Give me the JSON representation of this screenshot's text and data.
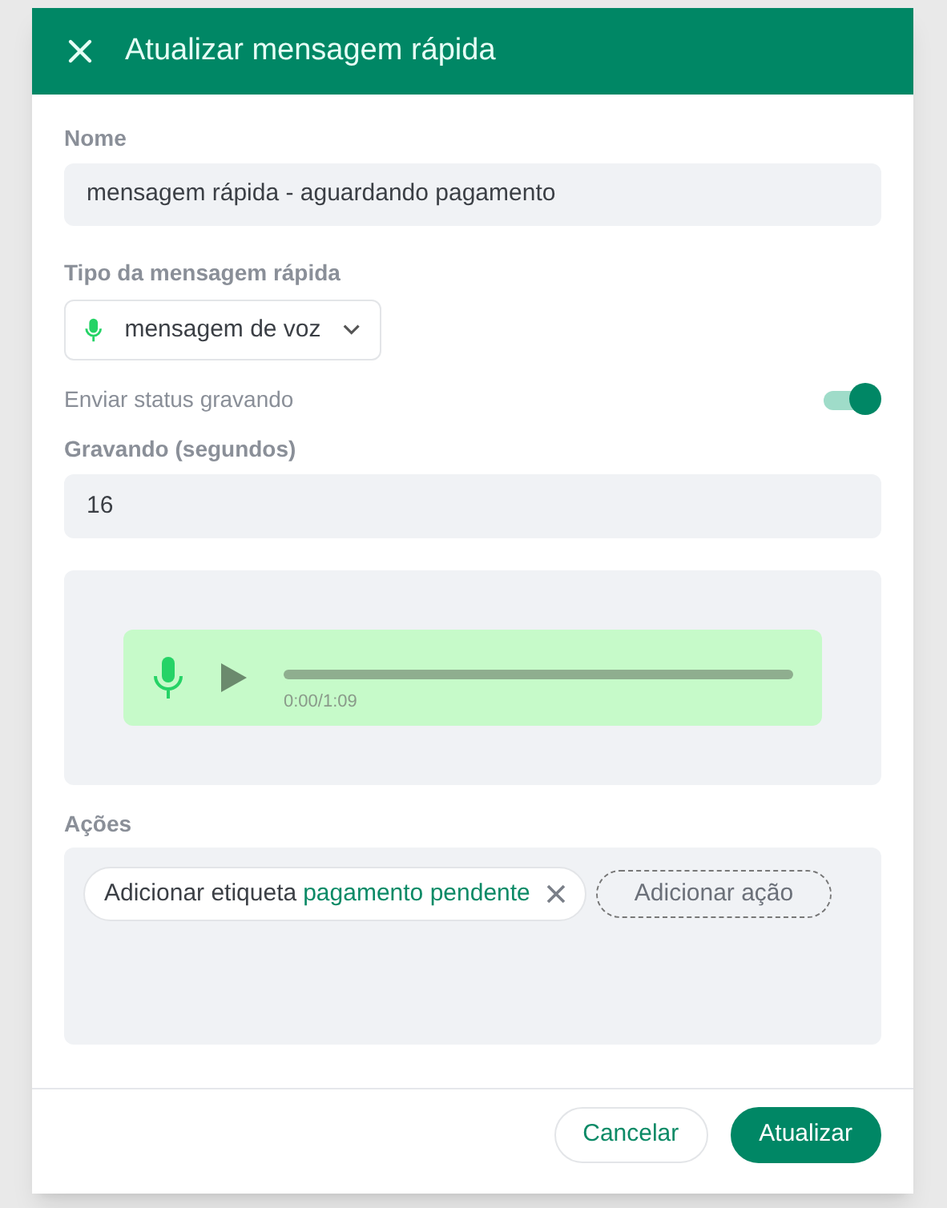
{
  "dialog": {
    "title": "Atualizar mensagem rápida"
  },
  "name_field": {
    "label": "Nome",
    "value": "mensagem rápida - aguardando pagamento"
  },
  "type_select": {
    "label": "Tipo da mensagem rápida",
    "value": "mensagem de voz"
  },
  "recording_status": {
    "label": "Enviar status gravando",
    "on": true
  },
  "seconds_field": {
    "label": "Gravando (segundos)",
    "value": "16"
  },
  "audio_player": {
    "time": "0:00/1:09",
    "level": 0
  },
  "actions": {
    "label": "Ações",
    "items": [
      {
        "text": "Adicionar etiqueta",
        "tag": "pagamento pendente"
      }
    ],
    "add_button": "Adicionar ação"
  },
  "buttons": [
    {
      "kind": "secondary",
      "label": "Cancelar"
    },
    {
      "kind": "primary",
      "label": "Atualizar"
    }
  ]
}
